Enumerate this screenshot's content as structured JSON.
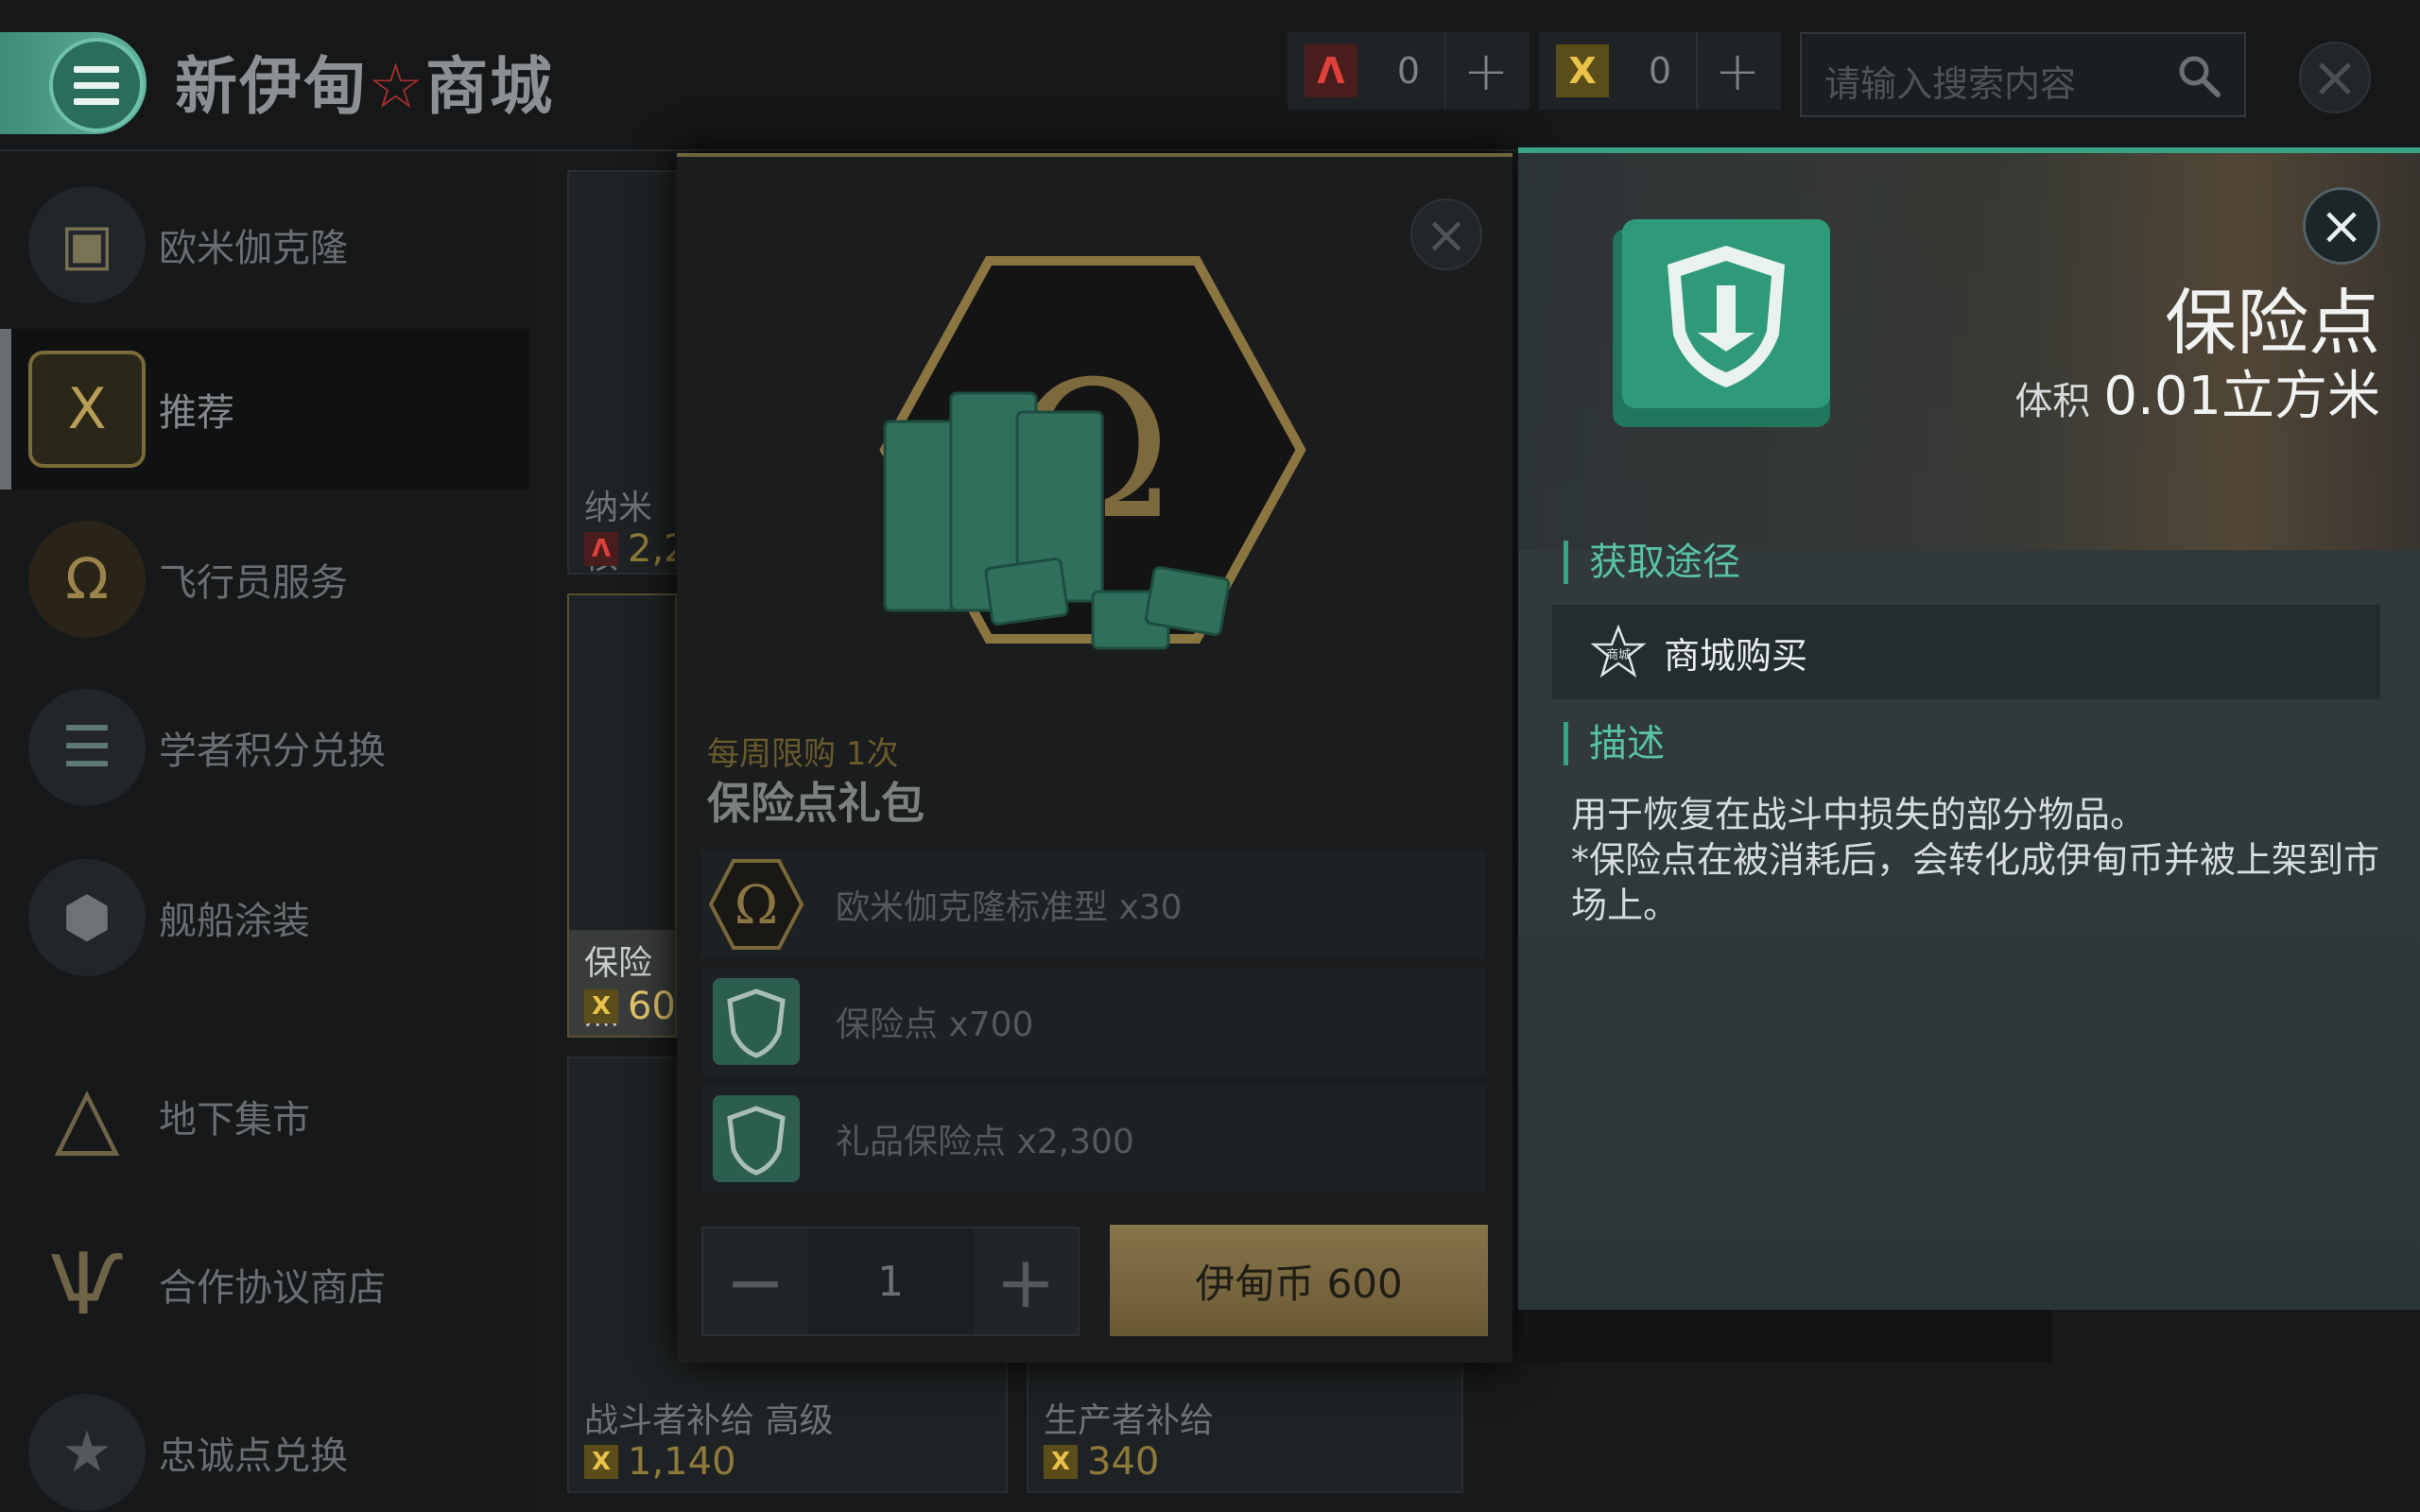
{
  "header": {
    "title": "新伊甸",
    "title_star": "☆",
    "title_suffix": "商城",
    "currency_a": {
      "icon": "aurum-icon",
      "value": "0",
      "plus": "+"
    },
    "currency_x": {
      "icon": "isk-icon",
      "value": "0",
      "plus": "+"
    },
    "search_placeholder": "请输入搜索内容"
  },
  "sidebar": {
    "items": [
      {
        "label": "欧米伽克隆",
        "icon": "omega-clone-icon"
      },
      {
        "label": "推荐",
        "icon": "recommend-icon",
        "active": true
      },
      {
        "label": "飞行员服务",
        "icon": "omega-icon"
      },
      {
        "label": "学者积分兑换",
        "icon": "scholar-icon"
      },
      {
        "label": "舰船涂装",
        "icon": "ship-skin-icon"
      },
      {
        "label": "地下集市",
        "icon": "underground-market-icon"
      },
      {
        "label": "合作协议商店",
        "icon": "cooperation-icon"
      },
      {
        "label": "忠诚点兑换",
        "icon": "loyalty-icon"
      }
    ]
  },
  "grid": {
    "cards": [
      {
        "name": "纳米核",
        "price": "2,2",
        "currency": "aurum"
      },
      {
        "name": "保险点",
        "price": "60",
        "currency": "isk"
      },
      {
        "name": "战斗者补给 高级",
        "price": "1,140",
        "currency": "isk"
      },
      {
        "name": "生产者补给",
        "price": "340",
        "currency": "isk"
      }
    ]
  },
  "package_modal": {
    "limit": "每周限购 1次",
    "title": "保险点礼包",
    "items": [
      {
        "label": "欧米伽克隆标准型 x30",
        "icon": "omega-icon"
      },
      {
        "label": "保险点 x700",
        "icon": "insurance-icon"
      },
      {
        "label": "礼品保险点 x2,300",
        "icon": "insurance-icon"
      }
    ],
    "quantity": "1",
    "minus": "−",
    "plus": "+",
    "buy_label": "伊甸币 600"
  },
  "detail": {
    "name": "保险点",
    "volume_label": "体积",
    "volume_value": "0.01立方米",
    "source_title": "获取途径",
    "source_item": "商城购买",
    "source_icon_text": "商城",
    "desc_title": "描述",
    "desc_line1": "用于恢复在战斗中损失的部分物品。",
    "desc_line2": "*保险点在被消耗后，会转化成伊甸币并被上架到市场上。"
  },
  "colors": {
    "accent_teal": "#3aa384",
    "gold": "#86744a",
    "aurum_red": "#e0403a",
    "isk_gold": "#e9c24a"
  }
}
